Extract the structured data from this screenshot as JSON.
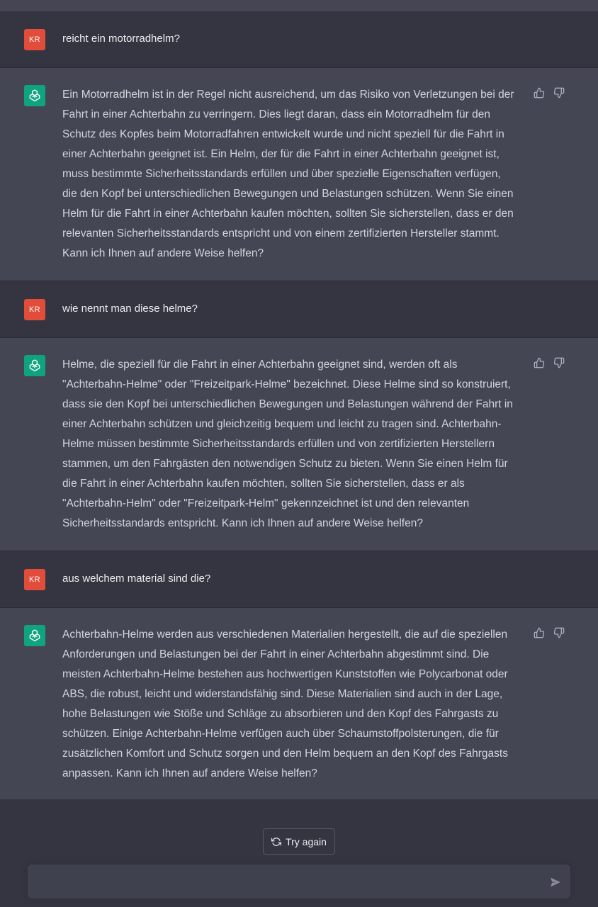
{
  "conversation": [
    {
      "role": "user",
      "avatar_initials": "KR",
      "text": "reicht ein motorradhelm?"
    },
    {
      "role": "assistant",
      "lines": [
        "Ein Motorradhelm ist in der Regel nicht ausreichend, um das Risiko von Verletzungen bei der",
        "Fahrt in einer Achterbahn zu verringern. Dies liegt daran, dass ein Motorradhelm für den",
        "Schutz des Kopfes beim Motorradfahren entwickelt wurde und nicht speziell für die Fahrt in",
        "einer Achterbahn geeignet ist. Ein Helm, der für die Fahrt in einer Achterbahn geeignet ist,",
        "muss bestimmte Sicherheitsstandards erfüllen und über spezielle Eigenschaften verfügen,",
        "die den Kopf bei unterschiedlichen Bewegungen und Belastungen schützen. Wenn Sie einen",
        "Helm für die Fahrt in einer Achterbahn kaufen möchten, sollten Sie sicherstellen, dass er den",
        "relevanten Sicherheitsstandards entspricht und von einem zertifizierten Hersteller stammt.",
        "Kann ich Ihnen auf andere Weise helfen?"
      ]
    },
    {
      "role": "user",
      "avatar_initials": "KR",
      "text": "wie nennt man diese helme?"
    },
    {
      "role": "assistant",
      "lines": [
        "Helme, die speziell für die Fahrt in einer Achterbahn geeignet sind, werden oft als",
        "\"Achterbahn-Helme\" oder \"Freizeitpark-Helme\" bezeichnet. Diese Helme sind so konstruiert,",
        "dass sie den Kopf bei unterschiedlichen Bewegungen und Belastungen während der Fahrt in",
        "einer Achterbahn schützen und gleichzeitig bequem und leicht zu tragen sind. Achterbahn-",
        "Helme müssen bestimmte Sicherheitsstandards erfüllen und von zertifizierten Herstellern",
        "stammen, um den Fahrgästen den notwendigen Schutz zu bieten. Wenn Sie einen Helm für",
        "die Fahrt in einer Achterbahn kaufen möchten, sollten Sie sicherstellen, dass er als",
        "\"Achterbahn-Helm\" oder \"Freizeitpark-Helm\" gekennzeichnet ist und den relevanten",
        "Sicherheitsstandards entspricht. Kann ich Ihnen auf andere Weise helfen?"
      ]
    },
    {
      "role": "user",
      "avatar_initials": "KR",
      "text": "aus welchem material sind die?"
    },
    {
      "role": "assistant",
      "lines": [
        "Achterbahn-Helme werden aus verschiedenen Materialien hergestellt, die auf die speziellen",
        "Anforderungen und Belastungen bei der Fahrt in einer Achterbahn abgestimmt sind. Die",
        "meisten Achterbahn-Helme bestehen aus hochwertigen Kunststoffen wie Polycarbonat oder",
        "ABS, die robust, leicht und widerstandsfähig sind. Diese Materialien sind auch in der Lage,",
        "hohe Belastungen wie Stöße und Schläge zu absorbieren und den Kopf des Fahrgasts zu",
        "schützen. Einige Achterbahn-Helme verfügen auch über Schaumstoffpolsterungen, die für",
        "zusätzlichen Komfort und Schutz sorgen und den Helm bequem an den Kopf des Fahrgasts",
        "anpassen. Kann ich Ihnen auf andere Weise helfen?"
      ]
    }
  ],
  "controls": {
    "try_again_label": "Try again",
    "input_value": "",
    "thumbs_up_icon": "thumbs-up-icon",
    "thumbs_down_icon": "thumbs-down-icon",
    "send_icon": "send-icon",
    "refresh_icon": "refresh-icon"
  },
  "colors": {
    "page_bg": "#343541",
    "assistant_bg": "#444654",
    "user_avatar": "#e24c3a",
    "assistant_avatar": "#10a37f",
    "input_bg": "#40414f"
  }
}
